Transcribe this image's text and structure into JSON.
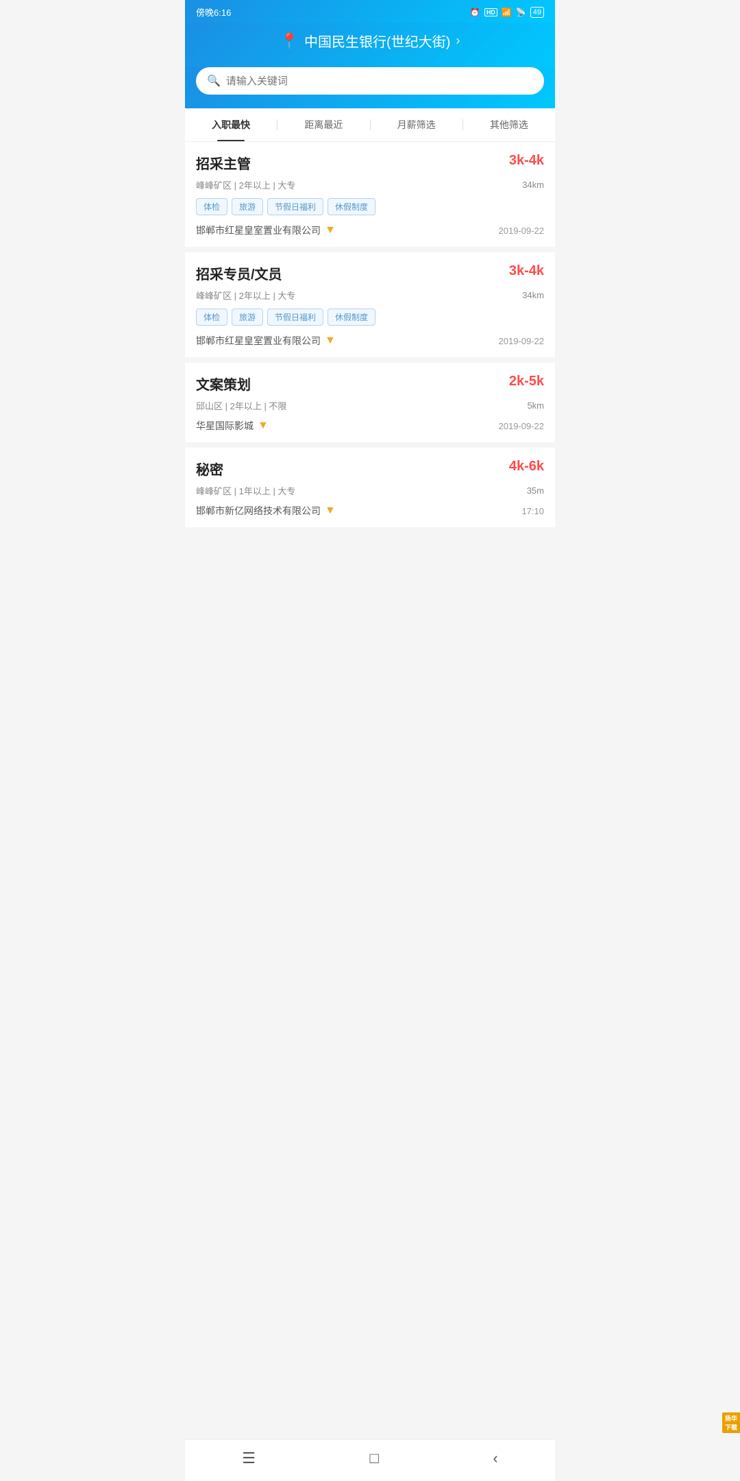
{
  "status": {
    "time": "傍晚6:16",
    "battery": "49"
  },
  "header": {
    "location": "中国民生银行(世纪大街)",
    "location_icon": "📍"
  },
  "search": {
    "placeholder": "请输入关键词"
  },
  "filters": [
    {
      "id": "fastest",
      "label": "入职最快",
      "active": true
    },
    {
      "id": "nearest",
      "label": "距离最近",
      "active": false
    },
    {
      "id": "salary",
      "label": "月薪筛选",
      "active": false
    },
    {
      "id": "other",
      "label": "其他筛选",
      "active": false
    }
  ],
  "jobs": [
    {
      "title": "招采主管",
      "salary": "3k-4k",
      "location": "峰峰矿区",
      "experience": "2年以上",
      "education": "大专",
      "distance": "34km",
      "tags": [
        "体检",
        "旅游",
        "节假日福利",
        "休假制度"
      ],
      "company": "邯郸市红星皇室置业有限公司",
      "verified": true,
      "date": "2019-09-22"
    },
    {
      "title": "招采专员/文员",
      "salary": "3k-4k",
      "location": "峰峰矿区",
      "experience": "2年以上",
      "education": "大专",
      "distance": "34km",
      "tags": [
        "体检",
        "旅游",
        "节假日福利",
        "休假制度"
      ],
      "company": "邯郸市红星皇室置业有限公司",
      "verified": true,
      "date": "2019-09-22"
    },
    {
      "title": "文案策划",
      "salary": "2k-5k",
      "location": "邱山区",
      "experience": "2年以上",
      "education": "不限",
      "distance": "5km",
      "tags": [],
      "company": "华星国际影城",
      "verified": true,
      "date": "2019-09-22"
    },
    {
      "title": "秘密",
      "salary": "4k-6k",
      "location": "峰峰矿区",
      "experience": "1年以上",
      "education": "大专",
      "distance": "35m",
      "tags": [],
      "company": "邯郸市新亿网络技术有限公司",
      "verified": true,
      "date": "17:10"
    }
  ],
  "nav": {
    "menu_icon": "☰",
    "home_icon": "□",
    "back_icon": "‹"
  },
  "watermark": {
    "line1": "扬华",
    "line2": "下载"
  }
}
